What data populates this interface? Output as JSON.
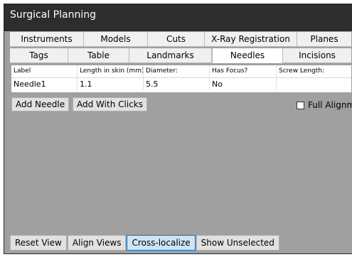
{
  "window": {
    "title": "Surgical Planning"
  },
  "tabs": {
    "row1": [
      {
        "label": "Instruments"
      },
      {
        "label": "Models"
      },
      {
        "label": "Cuts"
      },
      {
        "label": "X-Ray Registration"
      },
      {
        "label": "Planes"
      }
    ],
    "row2": [
      {
        "label": "Tags"
      },
      {
        "label": "Table"
      },
      {
        "label": "Landmarks"
      },
      {
        "label": "Needles",
        "active": true
      },
      {
        "label": "Incisions"
      }
    ]
  },
  "needles_table": {
    "columns": [
      "Label",
      "Length in skin (mm)",
      "Diameter:",
      "Has Focus?",
      "Screw Length:"
    ],
    "rows": [
      [
        "Needle1",
        "1.1",
        "5.5",
        "No",
        ""
      ]
    ]
  },
  "actions": {
    "add_needle": "Add Needle",
    "add_with_clicks": "Add With Clicks",
    "full_alignment": "Full Alignme",
    "full_alignment_checked": false
  },
  "bottom_bar": {
    "buttons": [
      {
        "label": "Reset View"
      },
      {
        "label": "Align Views"
      },
      {
        "label": "Cross-localize",
        "active": true
      },
      {
        "label": "Show Unselected"
      }
    ]
  },
  "colors": {
    "titlebar": "#2d2d2d",
    "panel_bg": "#a0a0a0",
    "active_button": "#cce4f7",
    "active_border": "#0078d7"
  }
}
